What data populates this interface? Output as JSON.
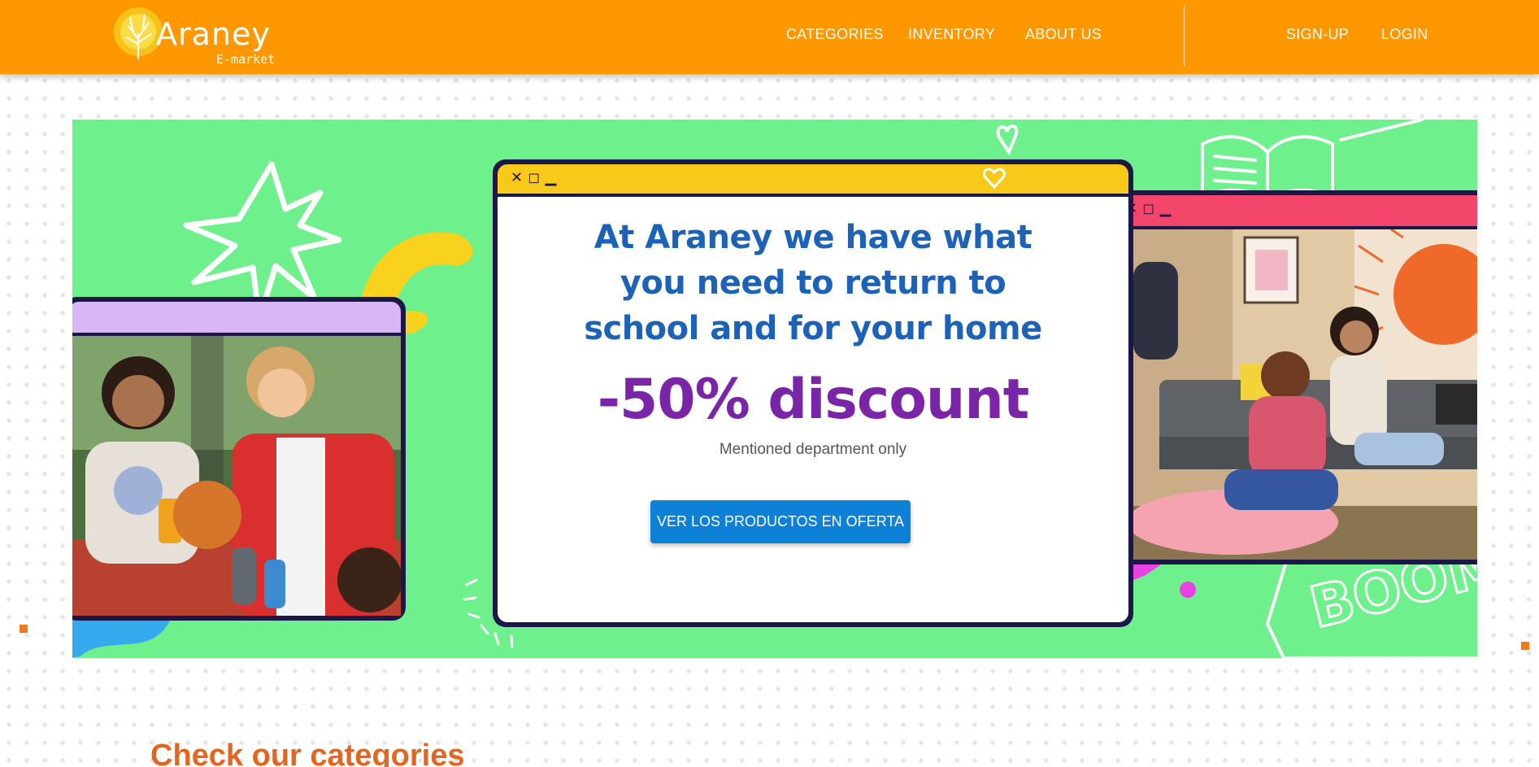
{
  "brand": {
    "name": "Araney",
    "subtitle": "E-market"
  },
  "nav": {
    "categories": "CATEGORIES",
    "inventory": "INVENTORY",
    "about": "ABOUT US",
    "signup": "SIGN-UP",
    "login": "LOGIN"
  },
  "banner": {
    "window_controls": "✕ ◻ ▁",
    "headline_lines": [
      "At Araney we have what",
      "you need to return to",
      "school and for your home"
    ],
    "discount": "-50% discount",
    "note": "Mentioned department only",
    "cta": "VER LOS PRODUCTOS EN OFERTA",
    "decor_text": "BOOM"
  },
  "sections": {
    "categories_title": "Check our categories"
  },
  "colors": {
    "header": "#ff9800",
    "banner_bg": "#6ef08c",
    "headline": "#1c63b8",
    "discount": "#7a24a8",
    "cta_bg": "#0d80d8",
    "section_title": "#e2661f"
  }
}
